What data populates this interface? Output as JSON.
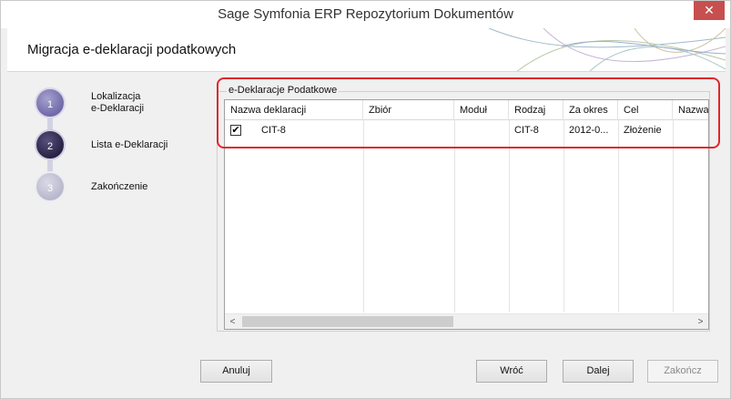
{
  "window": {
    "title": "Sage Symfonia ERP Repozytorium Dokumentów",
    "close_glyph": "✕"
  },
  "header": {
    "heading": "Migracja e-deklaracji podatkowych"
  },
  "steps": [
    {
      "number": "1",
      "label_line1": "Lokalizacja",
      "label_line2": "e-Deklaracji",
      "state": "done"
    },
    {
      "number": "2",
      "label_line1": "Lista e-Deklaracji",
      "label_line2": "",
      "state": "current"
    },
    {
      "number": "3",
      "label_line1": "Zakończenie",
      "label_line2": "",
      "state": "pending"
    }
  ],
  "group": {
    "title": "e-Deklaracje Podatkowe"
  },
  "grid": {
    "columns": [
      "Nazwa deklaracji",
      "Zbiór",
      "Moduł",
      "Rodzaj",
      "Za okres",
      "Cel",
      "Nazwa"
    ],
    "rows": [
      {
        "checked": true,
        "check_glyph": "✔",
        "nazwa": "CIT-8",
        "zbior": "",
        "modul": "",
        "rodzaj": "CIT-8",
        "okres": "2012-0...",
        "cel": "Złożenie",
        "nazwa2": ""
      }
    ],
    "scroll_left": "<",
    "scroll_right": ">"
  },
  "buttons": {
    "cancel": "Anuluj",
    "back": "Wróć",
    "next": "Dalej",
    "finish": "Zakończ"
  },
  "colors": {
    "highlight": "#e0262a",
    "close": "#c74f4f"
  }
}
